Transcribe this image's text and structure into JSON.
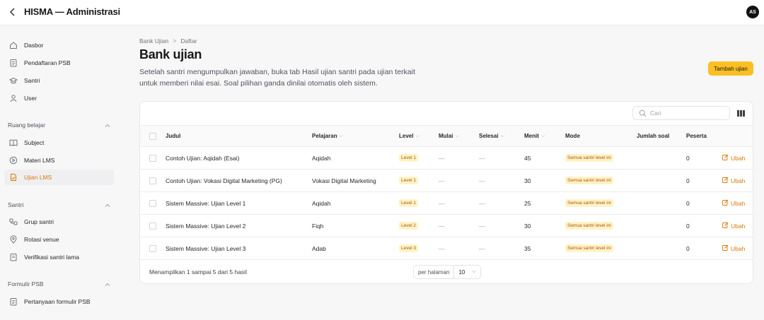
{
  "app": {
    "title": "HISMA — Administrasi",
    "avatar_initials": "AS"
  },
  "sidebar": {
    "top_items": [
      {
        "label": "Dasbor",
        "icon": "home-icon"
      },
      {
        "label": "Pendaftaran PSB",
        "icon": "document-icon"
      },
      {
        "label": "Santri",
        "icon": "graduation-cap-icon"
      },
      {
        "label": "User",
        "icon": "user-icon"
      }
    ],
    "groups": [
      {
        "label": "Ruang belajar",
        "items": [
          {
            "label": "Subject",
            "icon": "book-icon"
          },
          {
            "label": "Materi LMS",
            "icon": "play-icon"
          },
          {
            "label": "Ujian LMS",
            "icon": "exam-icon",
            "active": true
          }
        ]
      },
      {
        "label": "Santri",
        "items": [
          {
            "label": "Grup santri",
            "icon": "group-icon"
          },
          {
            "label": "Rotasi venue",
            "icon": "location-icon"
          },
          {
            "label": "Verifikasi santri lama",
            "icon": "document-check-icon"
          }
        ]
      },
      {
        "label": "Formulir PSB",
        "items": [
          {
            "label": "Pertanyaan formulir PSB",
            "icon": "form-icon"
          }
        ]
      }
    ]
  },
  "breadcrumb": {
    "parent": "Bank Ujian",
    "separator": ">",
    "current": "Daftar"
  },
  "page": {
    "title": "Bank ujian",
    "description": "Setelah santri mengumpulkan jawaban, buka tab Hasil ujian santri pada ujian terkait untuk memberi nilai esai. Soal pilihan ganda dinilai otomatis oleh sistem.",
    "add_button": "Tambah ujian"
  },
  "search": {
    "placeholder": "Cari",
    "value": ""
  },
  "table": {
    "headers": {
      "judul": "Judul",
      "pelajaran": "Pelajaran",
      "level": "Level",
      "mulai": "Mulai",
      "selesai": "Selesai",
      "menit": "Menit",
      "mode": "Mode",
      "jumlah_soal": "Jumlah soal",
      "peserta": "Peserta"
    },
    "rows": [
      {
        "judul": "Contoh Ujian: Aqidah (Esai)",
        "pelajaran": "Aqidah",
        "level": "Level 1",
        "mulai": "—",
        "selesai": "—",
        "menit": "45",
        "mode": "Semua santri level ini",
        "jumlah_soal": "",
        "peserta": "0",
        "action": "Ubah"
      },
      {
        "judul": "Contoh Ujian: Vokasi Digital Marketing (PG)",
        "pelajaran": "Vokasi Digital Marketing",
        "level": "Level 1",
        "mulai": "—",
        "selesai": "—",
        "menit": "30",
        "mode": "Semua santri level ini",
        "jumlah_soal": "",
        "peserta": "0",
        "action": "Ubah"
      },
      {
        "judul": "Sistem Massive: Ujian Level 1",
        "pelajaran": "Aqidah",
        "level": "Level 1",
        "mulai": "—",
        "selesai": "—",
        "menit": "25",
        "mode": "Semua santri level ini",
        "jumlah_soal": "",
        "peserta": "0",
        "action": "Ubah"
      },
      {
        "judul": "Sistem Massive: Ujian Level 2",
        "pelajaran": "Fiqh",
        "level": "Level 2",
        "mulai": "—",
        "selesai": "—",
        "menit": "30",
        "mode": "Semua santri level ini",
        "jumlah_soal": "",
        "peserta": "0",
        "action": "Ubah"
      },
      {
        "judul": "Sistem Massive: Ujian Level 3",
        "pelajaran": "Adab",
        "level": "Level 3",
        "mulai": "—",
        "selesai": "—",
        "menit": "35",
        "mode": "Semua santri level ini",
        "jumlah_soal": "",
        "peserta": "0",
        "action": "Ubah"
      }
    ]
  },
  "pagination": {
    "summary": "Menampilkan 1 sampai 5 dari 5 hasil",
    "per_page_label": "per halaman",
    "per_page_value": "10"
  },
  "colors": {
    "accent": "#d97706",
    "button": "#fbbf24",
    "badge_bg": "#fef3c7",
    "badge_text": "#b45309"
  }
}
